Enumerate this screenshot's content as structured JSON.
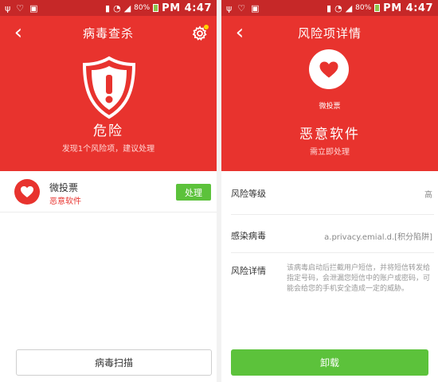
{
  "status_bar": {
    "battery": "80%",
    "time": "PM 4:47"
  },
  "left": {
    "header": {
      "title": "病毒查杀",
      "danger_title": "危险",
      "danger_subtitle": "发现1个风险项，建议处理"
    },
    "items": [
      {
        "name": "微投票",
        "tag": "恶意软件",
        "action_label": "处理"
      }
    ],
    "scan_label": "病毒扫描"
  },
  "right": {
    "header": {
      "title": "风险项详情",
      "app_name": "微投票",
      "risk_title": "恶意软件",
      "risk_subtitle": "需立即处理"
    },
    "details": {
      "level_label": "风险等级",
      "level_value": "高",
      "virus_label": "感染病毒",
      "virus_value": "a.privacy.emial.d.[积分陷阱]",
      "desc_label": "风险详情",
      "desc_value": "该病毒启动后拦截用户短信，并将短信转发给指定号码，会泄漏您短信中的账户或密码，可能会给您的手机安全造成一定的威胁。"
    },
    "uninstall_label": "卸载"
  },
  "colors": {
    "red": "#e8332e",
    "status_red": "#c62828",
    "green": "#5cc23b"
  },
  "icons": [
    "usb-icon",
    "shield-status-icon",
    "image-icon",
    "vibrate-icon",
    "wifi-icon",
    "signal-icon",
    "battery-icon",
    "back-icon",
    "gear-icon",
    "warning-shield-icon",
    "heart-icon"
  ]
}
